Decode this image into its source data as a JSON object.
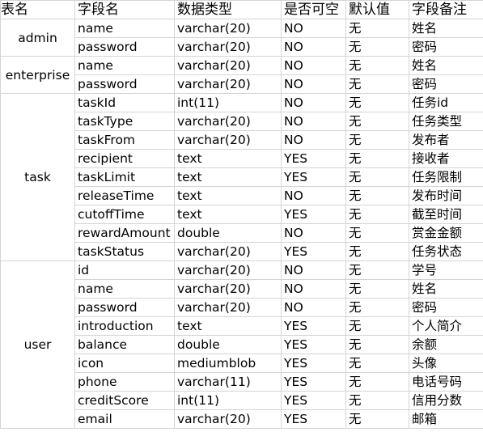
{
  "headers": [
    "表名",
    "字段名",
    "数据类型",
    "是否可空",
    "默认值",
    "字段备注"
  ],
  "groups": [
    {
      "table": "admin",
      "fields": [
        [
          "name",
          "varchar(20)",
          "NO",
          "无",
          "姓名"
        ],
        [
          "password",
          "varchar(20)",
          "NO",
          "无",
          "密码"
        ]
      ]
    },
    {
      "table": "enterprise",
      "fields": [
        [
          "name",
          "varchar(20)",
          "NO",
          "无",
          "姓名"
        ],
        [
          "password",
          "varchar(20)",
          "NO",
          "无",
          "密码"
        ]
      ]
    },
    {
      "table": "task",
      "fields": [
        [
          "taskId",
          "int(11)",
          "NO",
          "无",
          "任务id"
        ],
        [
          "taskType",
          "varchar(20)",
          "NO",
          "无",
          "任务类型"
        ],
        [
          "taskFrom",
          "varchar(20)",
          "NO",
          "无",
          "发布者"
        ],
        [
          "recipient",
          "text",
          "YES",
          "无",
          "接收者"
        ],
        [
          "taskLimit",
          "text",
          "YES",
          "无",
          "任务限制"
        ],
        [
          "releaseTime",
          "text",
          "NO",
          "无",
          "发布时间"
        ],
        [
          "cutoffTime",
          "text",
          "YES",
          "无",
          "截至时间"
        ],
        [
          "rewardAmount",
          "double",
          "NO",
          "无",
          "赏金金额"
        ],
        [
          "taskStatus",
          "varchar(20)",
          "YES",
          "无",
          "任务状态"
        ]
      ]
    },
    {
      "table": "user",
      "fields": [
        [
          "id",
          "varchar(20)",
          "NO",
          "无",
          "学号"
        ],
        [
          "name",
          "varchar(20)",
          "NO",
          "无",
          "姓名"
        ],
        [
          "password",
          "varchar(20)",
          "NO",
          "无",
          "密码"
        ],
        [
          "introduction",
          "text",
          "YES",
          "无",
          "个人简介"
        ],
        [
          "balance",
          "double",
          "YES",
          "无",
          "余额"
        ],
        [
          "icon",
          "mediumblob",
          "YES",
          "无",
          "头像"
        ],
        [
          "phone",
          "varchar(11)",
          "YES",
          "无",
          "电话号码"
        ],
        [
          "creditScore",
          "int(11)",
          "YES",
          "无",
          "信用分数"
        ],
        [
          "email",
          "varchar(20)",
          "YES",
          "无",
          "邮箱"
        ]
      ]
    }
  ]
}
